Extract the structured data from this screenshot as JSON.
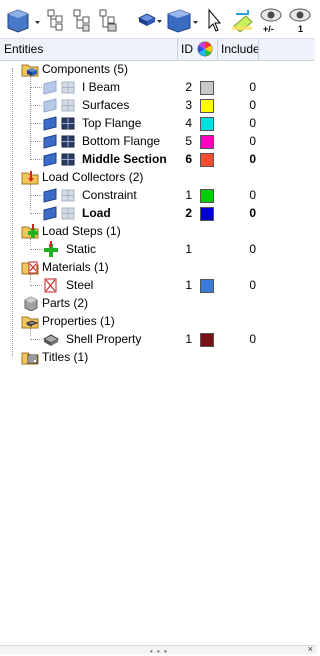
{
  "toolbar": {
    "buttons": [
      {
        "name": "display-mode-dropdown",
        "icon": "cube-dropdown-icon"
      },
      {
        "name": "entity-list-options",
        "icon": "tree-list-icon"
      },
      {
        "name": "entity-hierarchy",
        "icon": "tree-hierarchy-icon"
      },
      {
        "name": "entity-filter",
        "icon": "tree-filter-icon"
      },
      {
        "name": "color-mode-dropdown",
        "icon": "solid-cube-dropdown-icon"
      },
      {
        "name": "display-style-dropdown",
        "icon": "solid-box-dropdown-icon"
      },
      {
        "name": "select-arrow",
        "icon": "pointer-icon"
      },
      {
        "name": "isolate",
        "icon": "isolate-icon"
      },
      {
        "name": "show-hide-toggle",
        "icon": "eye-plus-minus-icon",
        "label": "+/-"
      },
      {
        "name": "show-only",
        "icon": "eye-one-icon",
        "label": "1"
      }
    ]
  },
  "header": {
    "entities": "Entities",
    "id": "ID",
    "color_icon": "color-wheel-icon",
    "include": "Include"
  },
  "tree": [
    {
      "label": "Components (5)",
      "level": 0,
      "type": "folder",
      "icon": "components-folder-icon"
    },
    {
      "label": "I Beam",
      "level": 1,
      "id": "2",
      "color": "#c8c8c8",
      "include": "0",
      "dim": true
    },
    {
      "label": "Surfaces",
      "level": 1,
      "id": "3",
      "color": "#ffff00",
      "include": "0",
      "dim": true
    },
    {
      "label": "Top Flange",
      "level": 1,
      "id": "4",
      "color": "#00e0e0",
      "include": "0"
    },
    {
      "label": "Bottom Flange",
      "level": 1,
      "id": "5",
      "color": "#ff00c0",
      "include": "0"
    },
    {
      "label": "Middle Section",
      "level": 1,
      "id": "6",
      "color": "#f05030",
      "include": "0",
      "bold": true
    },
    {
      "label": "Load Collectors (2)",
      "level": 0,
      "type": "folder",
      "icon": "load-collector-icon"
    },
    {
      "label": "Constraint",
      "level": 1,
      "id": "1",
      "color": "#00cc00",
      "include": "0",
      "dim": true
    },
    {
      "label": "Load",
      "level": 1,
      "id": "2",
      "color": "#0000cc",
      "include": "0",
      "bold": true
    },
    {
      "label": "Load Steps (1)",
      "level": 0,
      "type": "folder",
      "icon": "load-step-icon"
    },
    {
      "label": "Static",
      "level": 1,
      "id": "1",
      "include": "0",
      "icon": "static-step-icon"
    },
    {
      "label": "Materials (1)",
      "level": 0,
      "type": "folder",
      "icon": "material-icon"
    },
    {
      "label": "Steel",
      "level": 1,
      "id": "1",
      "color": "#3c7ad8",
      "include": "0",
      "icon": "material-item-icon"
    },
    {
      "label": "Parts (2)",
      "level": 0,
      "type": "folder",
      "icon": "parts-icon"
    },
    {
      "label": "Properties (1)",
      "level": 0,
      "type": "folder",
      "icon": "property-icon"
    },
    {
      "label": "Shell Property",
      "level": 1,
      "id": "1",
      "color": "#7a1018",
      "include": "0",
      "icon": "shell-property-icon"
    },
    {
      "label": "Titles (1)",
      "level": 0,
      "type": "folder",
      "icon": "titles-icon"
    }
  ]
}
